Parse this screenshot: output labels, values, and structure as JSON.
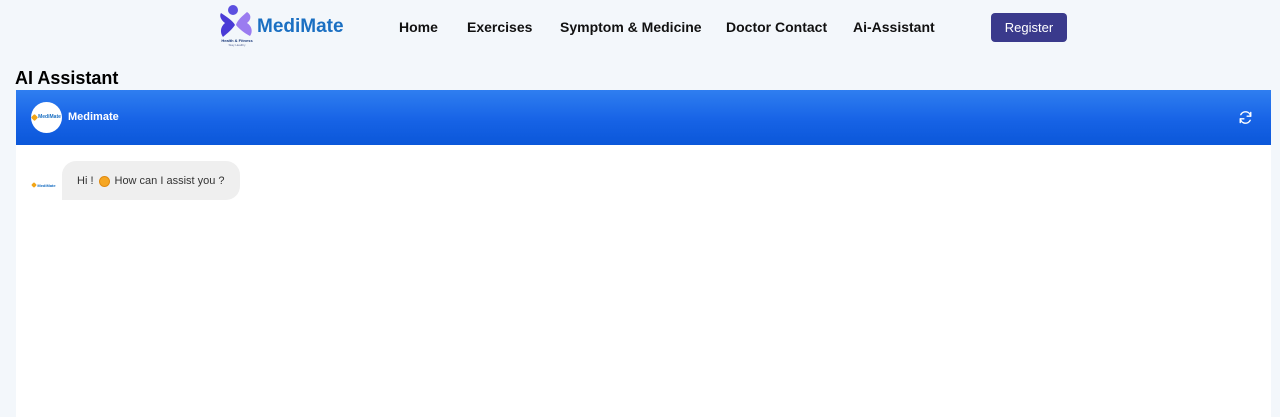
{
  "brand": {
    "name": "MediMate",
    "tagline": "Health & Fitness",
    "tagline_sub": "Stay Healthy"
  },
  "nav": {
    "items": [
      {
        "label": "Home"
      },
      {
        "label": "Exercises"
      },
      {
        "label": "Symptom & Medicine"
      },
      {
        "label": "Doctor Contact"
      },
      {
        "label": "Ai-Assistant"
      }
    ],
    "register_label": "Register"
  },
  "page": {
    "title": "AI Assistant"
  },
  "chat": {
    "bot_name": "Medimate",
    "avatar_text": "MediMate",
    "messages": [
      {
        "sender": "bot",
        "text_before": "Hi !",
        "emoji": "hugging-face",
        "text_after": "How can I assist you ?"
      }
    ]
  },
  "colors": {
    "page_bg": "#f3f7fb",
    "brand_blue": "#1a6fc2",
    "header_gradient_top": "#2f7ef0",
    "header_gradient_bottom": "#0b57d9",
    "register_bg": "#3a3a8c",
    "bubble_bg": "#efefef"
  },
  "icons": {
    "logo": "medimate-logo-icon",
    "refresh": "refresh-icon"
  }
}
